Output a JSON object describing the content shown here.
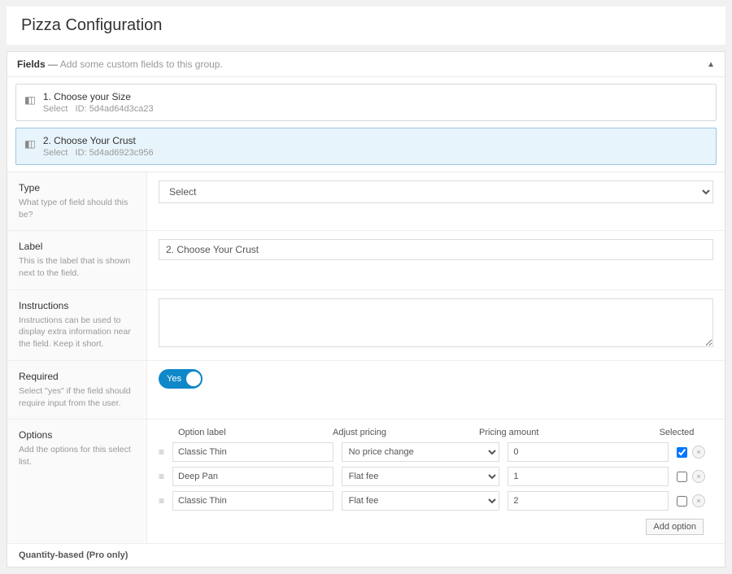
{
  "header": {
    "title": "Pizza Configuration"
  },
  "panel": {
    "title_strong": "Fields",
    "title_sep": " — ",
    "hint": "Add some custom fields to this group."
  },
  "fields": [
    {
      "name": "1. Choose your Size",
      "type": "Select",
      "id": "5d4ad64d3ca23"
    },
    {
      "name": "2. Choose Your Crust",
      "type": "Select",
      "id": "5d4ad6923c956"
    }
  ],
  "settings": {
    "type": {
      "label": "Type",
      "desc": "What type of field should this be?",
      "value": "Select"
    },
    "label": {
      "label": "Label",
      "desc": "This is the label that is shown next to the field.",
      "value": "2. Choose Your Crust"
    },
    "instructions": {
      "label": "Instructions",
      "desc": "Instructions can be used to display extra information near the field. Keep it short.",
      "value": ""
    },
    "required": {
      "label": "Required",
      "desc": "Select \"yes\" if the field should require input from the user.",
      "value": "Yes"
    },
    "options": {
      "label": "Options",
      "desc": "Add the options for this select list.",
      "headers": {
        "option_label": "Option label",
        "adjust": "Adjust pricing",
        "amount": "Pricing amount",
        "selected": "Selected"
      },
      "rows": [
        {
          "label": "Classic Thin",
          "adjust": "No price change",
          "amount": "0",
          "selected": true
        },
        {
          "label": "Deep Pan",
          "adjust": "Flat fee",
          "amount": "1",
          "selected": false
        },
        {
          "label": "Classic Thin",
          "adjust": "Flat fee",
          "amount": "2",
          "selected": false
        }
      ],
      "add_button": "Add option"
    }
  },
  "footer_cut": "Quantity-based (Pro only)"
}
